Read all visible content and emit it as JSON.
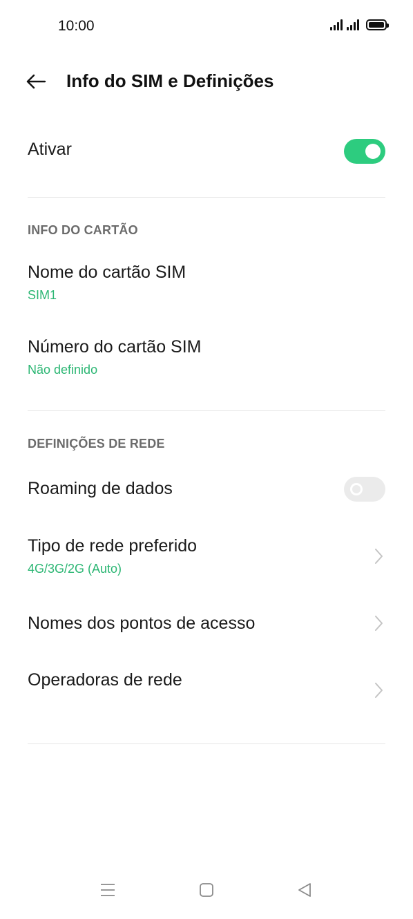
{
  "status_bar": {
    "time": "10:00",
    "icons": [
      "signal-icon",
      "signal-icon",
      "battery-icon"
    ]
  },
  "header": {
    "title": "Info do SIM e Definições",
    "back_icon": "arrow-left-icon"
  },
  "activate": {
    "label": "Ativar",
    "toggle_on": true
  },
  "card_info": {
    "section_title": "INFO DO CARTÃO",
    "sim_name": {
      "label": "Nome do cartão SIM",
      "value": "SIM1"
    },
    "sim_number": {
      "label": "Número do cartão SIM",
      "value": "Não definido"
    }
  },
  "network": {
    "section_title": "DEFINIÇÕES DE REDE",
    "roaming": {
      "label": "Roaming de dados",
      "toggle_on": false
    },
    "preferred_type": {
      "label": "Tipo de rede preferido",
      "value": "4G/3G/2G (Auto)"
    },
    "apn": {
      "label": "Nomes dos pontos de acesso"
    },
    "operators": {
      "label": "Operadoras de rede"
    }
  },
  "nav_bar": {
    "icons": [
      "menu-icon",
      "home-icon",
      "back-triangle-icon"
    ]
  },
  "colors": {
    "accent": "#2dcc7f",
    "subtext_green": "#2bb673",
    "section_gray": "#6b6b6b"
  }
}
